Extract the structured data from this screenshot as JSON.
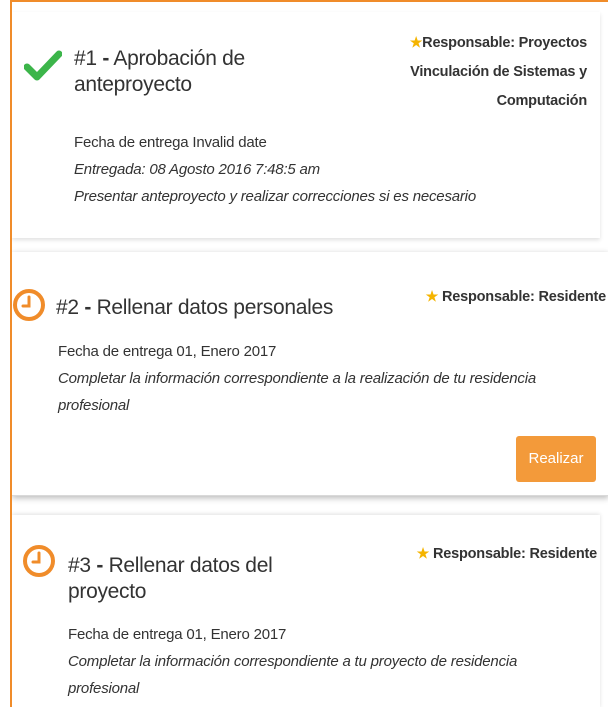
{
  "colors": {
    "accent": "#f08c2a",
    "success": "#3cb54a",
    "star": "#f5b400",
    "button": "#f39a3a"
  },
  "tasks": [
    {
      "status_icon": "check-icon",
      "number": "#1",
      "dash": "-",
      "title": "Aprobación de anteproyecto",
      "responsible_lines": [
        "Responsable: Proyectos",
        "Vinculación de Sistemas y",
        "Computación"
      ],
      "due": "Fecha de entrega Invalid date",
      "delivered": "Entregada: 08 Agosto 2016 7:48:5 am",
      "description": "Presentar anteproyecto y realizar correcciones si es necesario"
    },
    {
      "status_icon": "clock-icon",
      "number": "#2",
      "dash": "-",
      "title": "Rellenar datos personales",
      "responsible_lines": [
        "Responsable: Residente"
      ],
      "due": "Fecha de entrega 01, Enero 2017",
      "description_lines": [
        "Completar la información correspondiente a la realización de tu residencia",
        "profesional"
      ],
      "action_label": "Realizar"
    },
    {
      "status_icon": "clock-icon",
      "number": "#3",
      "dash": "-",
      "title_lines": [
        "Rellenar datos del",
        "proyecto"
      ],
      "responsible_lines": [
        "Responsable: Residente"
      ],
      "due": "Fecha de entrega 01, Enero 2017",
      "description_lines": [
        "Completar la información correspondiente a tu proyecto de residencia",
        "profesional"
      ]
    }
  ]
}
